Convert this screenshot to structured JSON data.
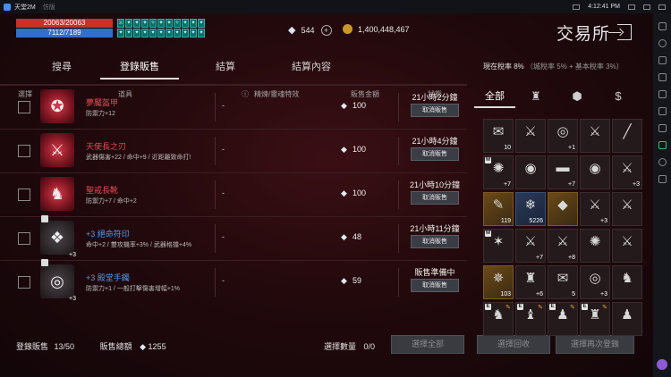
{
  "window": {
    "app_name": "天堂2M",
    "subtitle": "仿版",
    "time": "4:12:41 PM"
  },
  "hud": {
    "hp": "20063/20063",
    "mp": "7112/7189",
    "buffs": [
      "⚔",
      "✦",
      "✦",
      "✦",
      "✧",
      "✦",
      "✦",
      "✧",
      "✦",
      "✦",
      "✦",
      "✦",
      "✦",
      "✦",
      "✦",
      "✦",
      "✦",
      "✦",
      "✦",
      "✦",
      "✦",
      "✦"
    ],
    "diamonds": "544",
    "gold": "1,400,448,467"
  },
  "title": "交易所",
  "tabs": [
    "搜尋",
    "登錄販售",
    "結算",
    "結算內容"
  ],
  "tax": {
    "label": "現在稅率",
    "value": "8%",
    "detail": "（城稅率 5% + 基本稅率 3%）"
  },
  "columns": {
    "select": "選擇",
    "item": "道具",
    "refine": "精煉/靈魂特效",
    "price": "販售金額",
    "status": "狀態"
  },
  "rows": [
    {
      "name": "夢魘盔甲",
      "color": "red",
      "stat": "防禦力+12",
      "refine": "-",
      "price": "100",
      "status": "21小時2分鐘",
      "button": "取消販售",
      "icon": "✪",
      "bg": "red",
      "count": ""
    },
    {
      "name": "天使長之刃",
      "color": "red",
      "stat": "武器傷害+22 / 命中+9 / 近距離致命打!",
      "refine": "-",
      "price": "100",
      "status": "21小時4分鐘",
      "button": "取消販售",
      "icon": "⚔",
      "bg": "red",
      "count": ""
    },
    {
      "name": "聖戒長靴",
      "color": "red",
      "stat": "防禦力+7 / 命中+2",
      "refine": "-",
      "price": "100",
      "status": "21小時10分鐘",
      "button": "取消販售",
      "icon": "♞",
      "bg": "red",
      "count": ""
    },
    {
      "name": "+3 絕命符印",
      "color": "blue",
      "stat": "命中+2 / 雙攻機率+3% / 武器格擋+4%",
      "refine": "-",
      "price": "48",
      "status": "21小時11分鐘",
      "button": "取消販售",
      "icon": "❖",
      "bg": "dark",
      "count": "+3"
    },
    {
      "name": "+3 殿堂手鐲",
      "color": "blue",
      "stat": "防禦力+1 / 一般打擊傷害增幅+1%",
      "refine": "-",
      "price": "59",
      "status": "販售準備中",
      "button": "取消販售",
      "icon": "◎",
      "bg": "dark",
      "count": "+3"
    }
  ],
  "footer": {
    "registered_label": "登錄販售",
    "registered_value": "13/50",
    "total_label": "販售總額",
    "total_value": "1255",
    "selected_label": "選擇數量",
    "selected_value": "0/0",
    "select_all": "選擇全部",
    "select_recall": "選擇回收",
    "select_resell": "選擇再次登錄"
  },
  "inventory": {
    "tabs": [
      "全部",
      "♜",
      "⬢",
      "$"
    ],
    "slots": [
      {
        "icon": "✉",
        "count": "10",
        "cls": "",
        "tag": ""
      },
      {
        "icon": "⚔",
        "count": "",
        "cls": "",
        "tag": ""
      },
      {
        "icon": "◎",
        "count": "+1",
        "cls": "",
        "tag": ""
      },
      {
        "icon": "⚔",
        "count": "",
        "cls": "",
        "tag": ""
      },
      {
        "icon": "╱",
        "count": "",
        "cls": "",
        "tag": ""
      },
      {
        "icon": "✺",
        "count": "+7",
        "cls": "",
        "tag": "M"
      },
      {
        "icon": "◉",
        "count": "",
        "cls": "",
        "tag": ""
      },
      {
        "icon": "▬",
        "count": "+7",
        "cls": "",
        "tag": ""
      },
      {
        "icon": "◉",
        "count": "",
        "cls": "",
        "tag": ""
      },
      {
        "icon": "⚔",
        "count": "+3",
        "cls": "",
        "tag": ""
      },
      {
        "icon": "✎",
        "count": "119",
        "cls": "gold",
        "tag": ""
      },
      {
        "icon": "❄",
        "count": "5226",
        "cls": "blue",
        "tag": ""
      },
      {
        "icon": "◆",
        "count": "",
        "cls": "gold",
        "tag": ""
      },
      {
        "icon": "⚔",
        "count": "+3",
        "cls": "",
        "tag": ""
      },
      {
        "icon": "⚔",
        "count": "",
        "cls": "",
        "tag": ""
      },
      {
        "icon": "✶",
        "count": "",
        "cls": "",
        "tag": "M"
      },
      {
        "icon": "⚔",
        "count": "+7",
        "cls": "",
        "tag": ""
      },
      {
        "icon": "⚔",
        "count": "+8",
        "cls": "",
        "tag": ""
      },
      {
        "icon": "✺",
        "count": "",
        "cls": "",
        "tag": ""
      },
      {
        "icon": "⚔",
        "count": "",
        "cls": "",
        "tag": ""
      },
      {
        "icon": "✵",
        "count": "103",
        "cls": "gold",
        "tag": ""
      },
      {
        "icon": "♜",
        "count": "+6",
        "cls": "",
        "tag": ""
      },
      {
        "icon": "✉",
        "count": "5",
        "cls": "",
        "tag": ""
      },
      {
        "icon": "◎",
        "count": "+3",
        "cls": "",
        "tag": ""
      },
      {
        "icon": "♞",
        "count": "",
        "cls": "",
        "tag": ""
      },
      {
        "icon": "♞",
        "count": "",
        "cls": "",
        "tag": "E"
      },
      {
        "icon": "♝",
        "count": "",
        "cls": "",
        "tag": "E"
      },
      {
        "icon": "♟",
        "count": "",
        "cls": "",
        "tag": "E"
      },
      {
        "icon": "♜",
        "count": "",
        "cls": "",
        "tag": "E"
      },
      {
        "icon": "♟",
        "count": "",
        "cls": "",
        "tag": ""
      }
    ]
  }
}
